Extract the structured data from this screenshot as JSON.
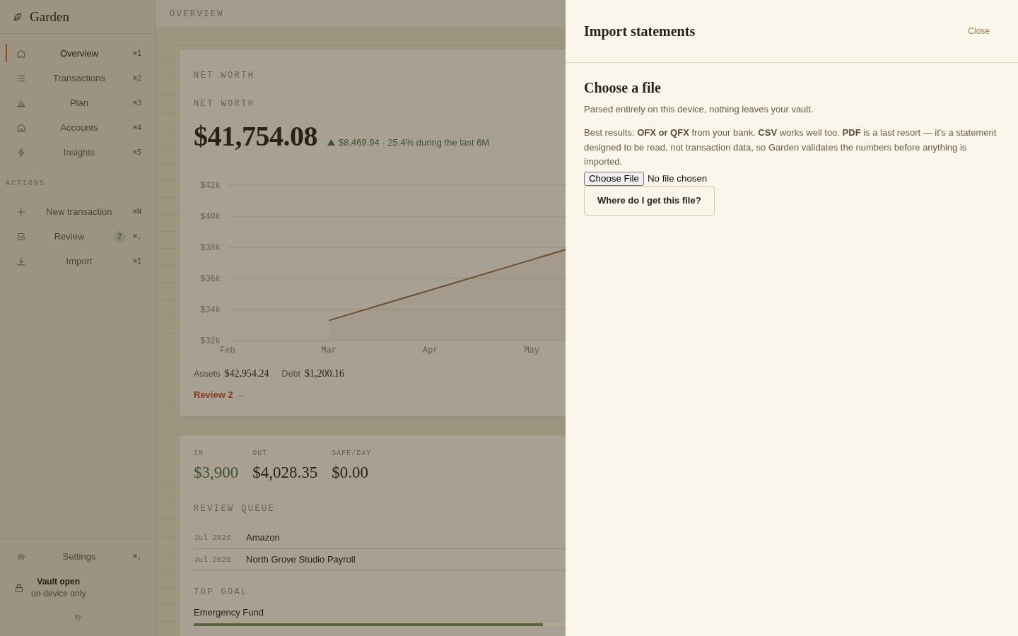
{
  "sidebar": {
    "brand": "Garden",
    "nav": [
      {
        "label": "Overview",
        "shortcut": "⌘1",
        "selected": true
      },
      {
        "label": "Transactions",
        "shortcut": "⌘2",
        "selected": false
      },
      {
        "label": "Plan",
        "shortcut": "⌘3",
        "selected": false
      },
      {
        "label": "Accounts",
        "shortcut": "⌘4",
        "selected": false
      },
      {
        "label": "Insights",
        "shortcut": "⌘5",
        "selected": false
      }
    ],
    "actions_heading": "ACTIONS",
    "actions": [
      {
        "label": "New transaction",
        "shortcut": "⌘N"
      },
      {
        "label": "Review",
        "badge": "2",
        "shortcut": "⌘."
      },
      {
        "label": "Import",
        "shortcut": "⌘I"
      }
    ],
    "settings": {
      "label": "Settings",
      "shortcut": "⌘,"
    },
    "vault": {
      "title": "Vault open",
      "subtitle": "on-device only"
    }
  },
  "topbar": {
    "title": "OVERVIEW"
  },
  "net_worth_card": {
    "section_label": "NET WORTH",
    "label": "NET WORTH",
    "value": "$41,754.08",
    "change": "$8,469.94 · 25.4% during the last 6M",
    "chart_data": {
      "type": "area",
      "categories": [
        "Feb",
        null,
        null,
        "Mar",
        null,
        null,
        "Apr",
        null,
        null,
        "May",
        null
      ],
      "series": [
        {
          "color": "#6b5030",
          "values": [
            null,
            null,
            null,
            33300,
            33950,
            34600,
            35250,
            35900,
            36550,
            37200,
            37850
          ]
        }
      ],
      "ylim": [
        32000,
        42000
      ],
      "yticks": [
        {
          "value": 42000,
          "label": "$42k"
        },
        {
          "value": 40000,
          "label": "$40k"
        },
        {
          "value": 38000,
          "label": "$38k"
        },
        {
          "value": 36000,
          "label": "$36k"
        },
        {
          "value": 34000,
          "label": "$34k"
        },
        {
          "value": 32000,
          "label": "$32k"
        }
      ],
      "grid": true
    },
    "assets_label": "Assets",
    "assets": "$42,954.24",
    "debt_label": "Debt",
    "debt": "$1,200.16",
    "review_link": "Review 2 →"
  },
  "summary_card": {
    "stats": [
      {
        "label": "IN",
        "value": "$3,900",
        "kind": "positive"
      },
      {
        "label": "OUT",
        "value": "$4,028.35",
        "kind": "plain"
      },
      {
        "label": "SAFE/DAY",
        "value": "$0.00",
        "kind": "plain"
      }
    ],
    "review_queue": {
      "heading": "REVIEW QUEUE",
      "rows": [
        {
          "date": "Jul 2026",
          "payee": "Amazon"
        },
        {
          "date": "Jul 2026",
          "payee": "North Grove Studio Payroll"
        }
      ]
    },
    "top_goal": {
      "heading": "TOP GOAL",
      "name": "Emergency Fund",
      "level": 0.94
    }
  },
  "drawer": {
    "title": "Import statements",
    "close": "Close",
    "section_title": "Choose a file",
    "note": "Parsed entirely on this device, nothing leaves your vault.",
    "details": "Best results: **OFX or QFX** from your bank. **CSV** works well too. **PDF** is a last resort — it's a statement designed to be read, not transaction data, so Garden validates the numbers before anything is imported.",
    "file_input": {
      "button": "Choose File",
      "status": "No file chosen"
    },
    "help_button": "Where do I get this file?"
  }
}
